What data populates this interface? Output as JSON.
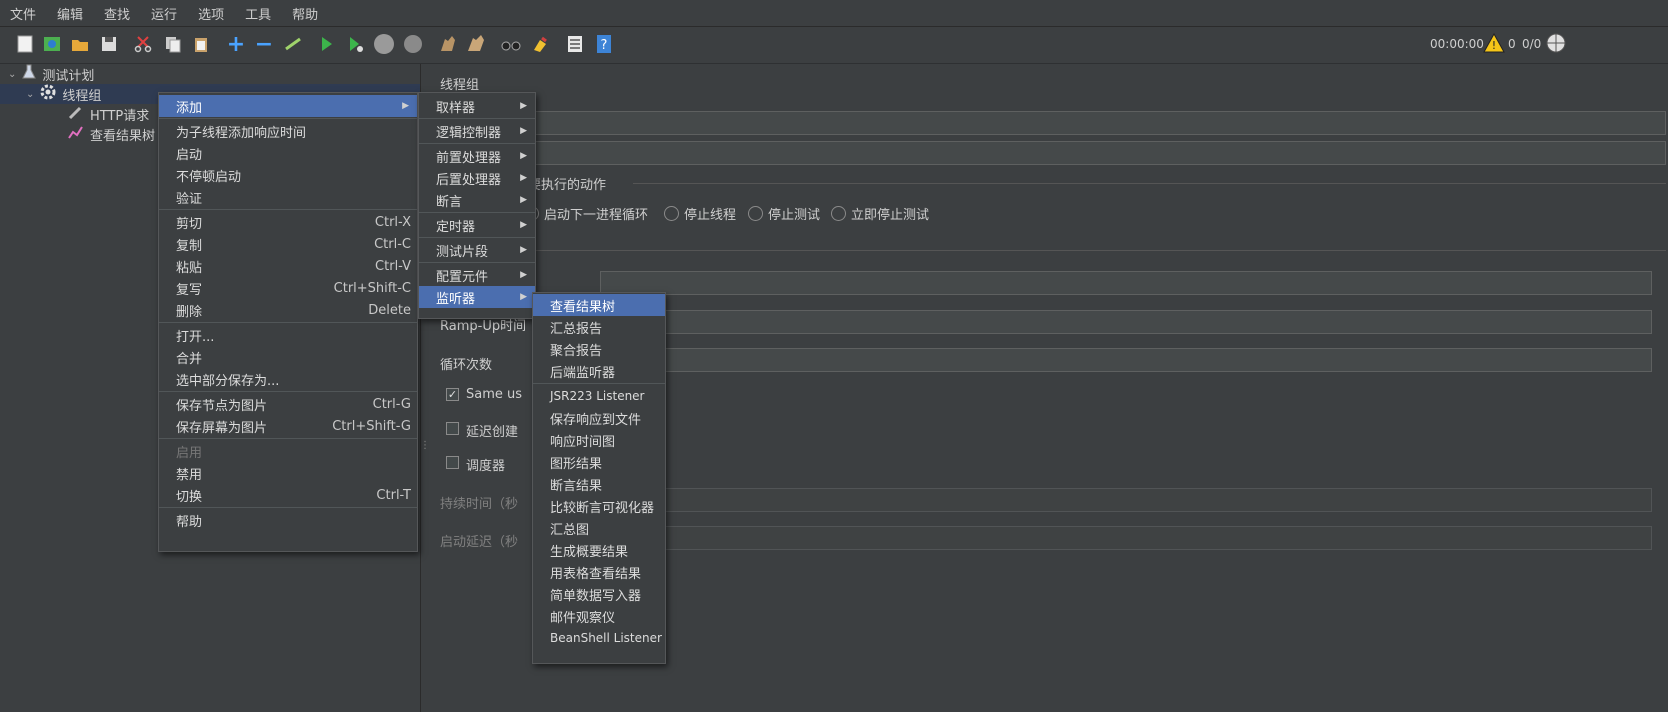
{
  "menubar": [
    "文件",
    "编辑",
    "查找",
    "运行",
    "选项",
    "工具",
    "帮助"
  ],
  "toolbar": {
    "icons": [
      "new-icon",
      "templates-icon",
      "open-icon",
      "save-icon",
      "cut-icon",
      "copy-icon",
      "paste-icon",
      "expand-icon",
      "collapse-icon",
      "toggle-icon",
      "start-icon",
      "start-no-pause-icon",
      "stop-icon",
      "shutdown-icon",
      "clear-icon",
      "clear-all-icon",
      "search-icon",
      "reset-search-icon",
      "function-helper-icon",
      "help-icon"
    ],
    "timer": "00:00:00",
    "warn_count": "0",
    "thread_ratio": "0/0"
  },
  "tree": {
    "root": "测试计划",
    "thread_group": "线程组",
    "children": [
      "HTTP请求",
      "查看结果树"
    ]
  },
  "panel": {
    "title": "线程组",
    "action_label": "要执行的动作",
    "radios": [
      "启动下一进程循环",
      "停止线程",
      "停止测试",
      "立即停止测试"
    ],
    "rampup_label": "Ramp-Up时间",
    "loop_label": "循环次数",
    "same_user_label": "Same us",
    "delay_label": "延迟创建",
    "scheduler_label": "调度器",
    "duration_label": "持续时间（秒",
    "startup_delay_label": "启动延迟（秒"
  },
  "context_menu": {
    "items": [
      {
        "label": "添加",
        "submenu": true,
        "highlight": true
      },
      {
        "label": "为子线程添加响应时间"
      },
      {
        "label": "启动"
      },
      {
        "label": "不停顿启动"
      },
      {
        "label": "验证"
      },
      {
        "label": "剪切",
        "shortcut": "Ctrl-X"
      },
      {
        "label": "复制",
        "shortcut": "Ctrl-C"
      },
      {
        "label": "粘贴",
        "shortcut": "Ctrl-V"
      },
      {
        "label": "复写",
        "shortcut": "Ctrl+Shift-C"
      },
      {
        "label": "删除",
        "shortcut": "Delete"
      },
      {
        "label": "打开..."
      },
      {
        "label": "合并"
      },
      {
        "label": "选中部分保存为..."
      },
      {
        "label": "保存节点为图片",
        "shortcut": "Ctrl-G"
      },
      {
        "label": "保存屏幕为图片",
        "shortcut": "Ctrl+Shift-G"
      },
      {
        "label": "启用",
        "disabled": true
      },
      {
        "label": "禁用"
      },
      {
        "label": "切换",
        "shortcut": "Ctrl-T"
      },
      {
        "label": "帮助"
      }
    ]
  },
  "add_menu": {
    "items": [
      "取样器",
      "逻辑控制器",
      "前置处理器",
      "后置处理器",
      "断言",
      "定时器",
      "测试片段",
      "配置元件",
      "监听器"
    ]
  },
  "listener_menu": {
    "items": [
      "查看结果树",
      "汇总报告",
      "聚合报告",
      "后端监听器",
      "JSR223 Listener",
      "保存响应到文件",
      "响应时间图",
      "图形结果",
      "断言结果",
      "比较断言可视化器",
      "汇总图",
      "生成概要结果",
      "用表格查看结果",
      "简单数据写入器",
      "邮件观察仪",
      "BeanShell Listener"
    ]
  }
}
